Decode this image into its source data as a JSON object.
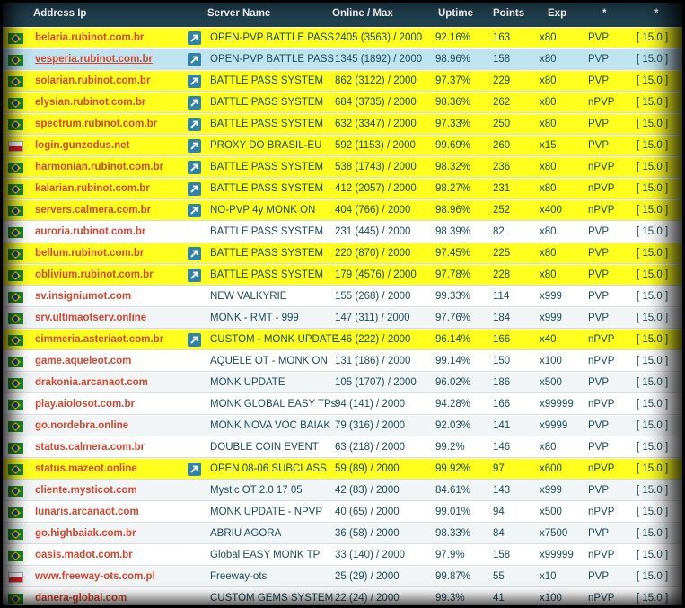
{
  "headers": {
    "address": "Address Ip",
    "server": "Server Name",
    "online": "Online / Max",
    "uptime": "Uptime",
    "points": "Points",
    "exp": "Exp",
    "star1": "*",
    "star2": "*"
  },
  "colors": {
    "highlight": "#ffff1e",
    "header_bg": "#20404f",
    "address_text": "#d2472f",
    "link_icon_bg": "#2f82ad",
    "row_text": "#1b4a5a"
  },
  "rows": [
    {
      "flag": "brazil-flag",
      "address": "belaria.rubinot.com.br",
      "link": true,
      "server": "OPEN-PVP BATTLE PASS",
      "online": "2405 (3563) / 2000",
      "uptime": "92.16%",
      "points": "163",
      "exp": "x80",
      "pvp": "PVP",
      "version": "[ 15.0 ]",
      "style": "hl"
    },
    {
      "flag": "brazil-flag",
      "address": "vesperia.rubinot.com.br",
      "link": true,
      "server": "OPEN-PVP BATTLE PASS",
      "online": "1345 (1892) / 2000",
      "uptime": "98.96%",
      "points": "158",
      "exp": "x80",
      "pvp": "PVP",
      "version": "[ 15.0 ]",
      "style": "sel"
    },
    {
      "flag": "brazil-flag",
      "address": "solarian.rubinot.com.br",
      "link": true,
      "server": "BATTLE PASS SYSTEM",
      "online": "862 (3122) / 2000",
      "uptime": "97.37%",
      "points": "229",
      "exp": "x80",
      "pvp": "PVP",
      "version": "[ 15.0 ]",
      "style": "hl"
    },
    {
      "flag": "brazil-flag",
      "address": "elysian.rubinot.com.br",
      "link": true,
      "server": "BATTLE PASS SYSTEM",
      "online": "684 (3735) / 2000",
      "uptime": "98.36%",
      "points": "262",
      "exp": "x80",
      "pvp": "nPVP",
      "version": "[ 15.0 ]",
      "style": "hl"
    },
    {
      "flag": "brazil-flag",
      "address": "spectrum.rubinot.com.br",
      "link": true,
      "server": "BATTLE PASS SYSTEM",
      "online": "632 (3347) / 2000",
      "uptime": "97.33%",
      "points": "250",
      "exp": "x80",
      "pvp": "PVP",
      "version": "[ 15.0 ]",
      "style": "hl"
    },
    {
      "flag": "poland-flag",
      "address": "login.gunzodus.net",
      "link": true,
      "server": "PROXY DO BRASIL-EU",
      "online": "592 (1153) / 2000",
      "uptime": "99.69%",
      "points": "260",
      "exp": "x15",
      "pvp": "PVP",
      "version": "[ 15.0 ]",
      "style": "hl"
    },
    {
      "flag": "brazil-flag",
      "address": "harmonian.rubinot.com.br",
      "link": true,
      "server": "BATTLE PASS SYSTEM",
      "online": "538 (1743) / 2000",
      "uptime": "98.32%",
      "points": "236",
      "exp": "x80",
      "pvp": "nPVP",
      "version": "[ 15.0 ]",
      "style": "hl"
    },
    {
      "flag": "brazil-flag",
      "address": "kalarian.rubinot.com.br",
      "link": true,
      "server": "BATTLE PASS SYSTEM",
      "online": "412 (2057) / 2000",
      "uptime": "98.27%",
      "points": "231",
      "exp": "x80",
      "pvp": "nPVP",
      "version": "[ 15.0 ]",
      "style": "hl"
    },
    {
      "flag": "brazil-flag",
      "address": "servers.calmera.com.br",
      "link": true,
      "server": "NO-PVP 4y MONK ON",
      "online": "404 (766) / 2000",
      "uptime": "98.96%",
      "points": "252",
      "exp": "x400",
      "pvp": "nPVP",
      "version": "[ 15.0 ]",
      "style": "hl"
    },
    {
      "flag": "brazil-flag",
      "address": "auroria.rubinot.com.br",
      "link": false,
      "server": "BATTLE PASS SYSTEM",
      "online": "231 (445) / 2000",
      "uptime": "98.39%",
      "points": "82",
      "exp": "x80",
      "pvp": "PVP",
      "version": "[ 15.0 ]",
      "style": "plain"
    },
    {
      "flag": "brazil-flag",
      "address": "bellum.rubinot.com.br",
      "link": true,
      "server": "BATTLE PASS SYSTEM",
      "online": "220 (870) / 2000",
      "uptime": "97.45%",
      "points": "225",
      "exp": "x80",
      "pvp": "PVP",
      "version": "[ 15.0 ]",
      "style": "hl"
    },
    {
      "flag": "brazil-flag",
      "address": "oblivium.rubinot.com.br",
      "link": true,
      "server": "BATTLE PASS SYSTEM",
      "online": "179 (4576) / 2000",
      "uptime": "97.78%",
      "points": "228",
      "exp": "x80",
      "pvp": "PVP",
      "version": "[ 15.0 ]",
      "style": "hl"
    },
    {
      "flag": "brazil-flag",
      "address": "sv.insigniumot.com",
      "link": false,
      "server": "NEW VALKYRIE",
      "online": "155 (268) / 2000",
      "uptime": "99.33%",
      "points": "114",
      "exp": "x999",
      "pvp": "PVP",
      "version": "[ 15.0 ]",
      "style": "plain"
    },
    {
      "flag": "brazil-flag",
      "address": "srv.ultimaotserv.online",
      "link": false,
      "server": "MONK - RMT - 999",
      "online": "147 (311) / 2000",
      "uptime": "97.76%",
      "points": "184",
      "exp": "x999",
      "pvp": "PVP",
      "version": "[ 15.0 ]",
      "style": "alt"
    },
    {
      "flag": "brazil-flag",
      "address": "cimmeria.asteriaot.com.br",
      "link": true,
      "server": "CUSTOM - MONK UPDATE",
      "online": "146 (222) / 2000",
      "uptime": "96.14%",
      "points": "166",
      "exp": "x40",
      "pvp": "nPVP",
      "version": "[ 15.0 ]",
      "style": "hl"
    },
    {
      "flag": "brazil-flag",
      "address": "game.aqueleot.com",
      "link": false,
      "server": "AQUELE OT - MONK ON",
      "online": "131 (186) / 2000",
      "uptime": "99.14%",
      "points": "150",
      "exp": "x100",
      "pvp": "nPVP",
      "version": "[ 15.0 ]",
      "style": "plain"
    },
    {
      "flag": "brazil-flag",
      "address": "drakonia.arcanaot.com",
      "link": false,
      "server": "MONK UPDATE",
      "online": "105 (1707) / 2000",
      "uptime": "96.02%",
      "points": "186",
      "exp": "x500",
      "pvp": "PVP",
      "version": "[ 15.0 ]",
      "style": "alt"
    },
    {
      "flag": "brazil-flag",
      "address": "play.aiolosot.com.br",
      "link": false,
      "server": "MONK GLOBAL EASY TPs",
      "online": "94 (141) / 2000",
      "uptime": "94.28%",
      "points": "166",
      "exp": "x99999",
      "pvp": "nPVP",
      "version": "[ 15.0 ]",
      "style": "plain"
    },
    {
      "flag": "brazil-flag",
      "address": "go.nordebra.online",
      "link": false,
      "server": "MONK NOVA VOC BAIAK",
      "online": "79 (316) / 2000",
      "uptime": "92.03%",
      "points": "141",
      "exp": "x9999",
      "pvp": "PVP",
      "version": "[ 15.0 ]",
      "style": "alt"
    },
    {
      "flag": "brazil-flag",
      "address": "status.calmera.com.br",
      "link": false,
      "server": "DOUBLE COIN EVENT",
      "online": "63 (218) / 2000",
      "uptime": "99.2%",
      "points": "146",
      "exp": "x80",
      "pvp": "PVP",
      "version": "[ 15.0 ]",
      "style": "plain"
    },
    {
      "flag": "brazil-flag",
      "address": "status.mazeot.online",
      "link": true,
      "server": "OPEN 08-06 SUBCLASS",
      "online": "59 (89) / 2000",
      "uptime": "99.92%",
      "points": "97",
      "exp": "x600",
      "pvp": "nPVP",
      "version": "[ 15.0 ]",
      "style": "hl"
    },
    {
      "flag": "brazil-flag",
      "address": "cliente.mysticot.com",
      "link": false,
      "server": "Mystic OT 2.0 17 05",
      "online": "42 (83) / 2000",
      "uptime": "84.61%",
      "points": "143",
      "exp": "x999",
      "pvp": "PVP",
      "version": "[ 15.0 ]",
      "style": "alt"
    },
    {
      "flag": "brazil-flag",
      "address": "lunaris.arcanaot.com",
      "link": false,
      "server": "MONK UPDATE - NPVP",
      "online": "40 (65) / 2000",
      "uptime": "99.01%",
      "points": "94",
      "exp": "x500",
      "pvp": "nPVP",
      "version": "[ 15.0 ]",
      "style": "plain"
    },
    {
      "flag": "brazil-flag",
      "address": "go.highbaiak.com.br",
      "link": false,
      "server": "ABRIU AGORA",
      "online": "36 (58) / 2000",
      "uptime": "98.33%",
      "points": "84",
      "exp": "x7500",
      "pvp": "PVP",
      "version": "[ 15.0 ]",
      "style": "alt"
    },
    {
      "flag": "brazil-flag",
      "address": "oasis.madot.com.br",
      "link": false,
      "server": "Global EASY MONK TP",
      "online": "33 (140) / 2000",
      "uptime": "97.9%",
      "points": "158",
      "exp": "x99999",
      "pvp": "nPVP",
      "version": "[ 15.0 ]",
      "style": "plain"
    },
    {
      "flag": "poland-flag",
      "address": "www.freeway-ots.com.pl",
      "link": false,
      "server": "Freeway-ots",
      "online": "25 (29) / 2000",
      "uptime": "99.87%",
      "points": "55",
      "exp": "x10",
      "pvp": "PVP",
      "version": "[ 15.0 ]",
      "style": "alt"
    },
    {
      "flag": "brazil-flag",
      "address": "danera-global.com",
      "link": false,
      "server": "CUSTOM GEMS SYSTEM",
      "online": "22 (24) / 2000",
      "uptime": "99.3%",
      "points": "41",
      "exp": "x100",
      "pvp": "nPVP",
      "version": "[ 15.0 ]",
      "style": "plain"
    }
  ]
}
